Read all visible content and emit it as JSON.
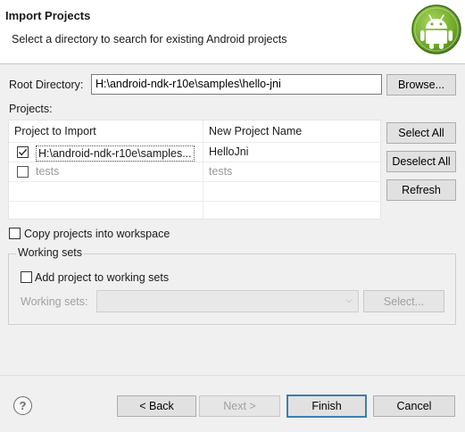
{
  "header": {
    "title": "Import Projects",
    "subtitle": "Select a directory to search for existing Android projects"
  },
  "root": {
    "label": "Root Directory:",
    "value": "H:\\android-ndk-r10e\\samples\\hello-jni",
    "browse_label": "Browse..."
  },
  "projects": {
    "label": "Projects:",
    "columns": [
      "Project to Import",
      "New Project Name"
    ],
    "rows": [
      {
        "path": "H:\\android-ndk-r10e\\samples...",
        "name": "HelloJni",
        "checked": true,
        "enabled": true
      },
      {
        "path": "tests",
        "name": "tests",
        "checked": false,
        "enabled": false
      }
    ]
  },
  "side_buttons": {
    "select_all": "Select All",
    "deselect_all": "Deselect All",
    "refresh": "Refresh"
  },
  "copy_into_workspace": {
    "label": "Copy projects into workspace",
    "checked": false
  },
  "working_sets": {
    "group_label": "Working sets",
    "add_label": "Add project to working sets",
    "add_checked": false,
    "sets_label": "Working sets:",
    "sets_value": "",
    "select_label": "Select..."
  },
  "footer": {
    "help_icon": "question-icon",
    "back": "< Back",
    "next": "Next >",
    "finish": "Finish",
    "cancel": "Cancel"
  },
  "colors": {
    "android_green": "#8cc63f",
    "default_button_border": "#3c7fb1"
  }
}
